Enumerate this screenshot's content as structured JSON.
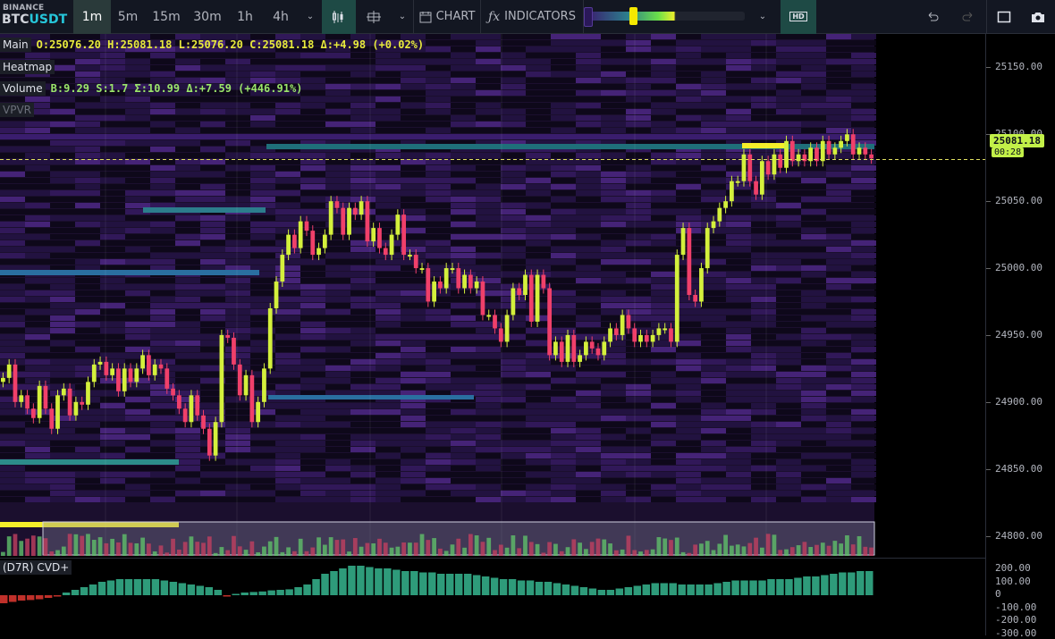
{
  "toolbar": {
    "exchange": "BINANCE",
    "symbol_base": "BTC",
    "symbol_quote": "USDT",
    "timeframes": [
      "1m",
      "5m",
      "15m",
      "30m",
      "1h",
      "4h"
    ],
    "active_timeframe": "1m",
    "chart_label": "CHART",
    "indicators_label": "INDICATORS",
    "hd_label": "HD"
  },
  "legend": {
    "main_tag": "Main",
    "main_values": "O:25076.20 H:25081.18 L:25076.20 C:25081.18 Δ:+4.98 (+0.02%)",
    "heatmap_tag": "Heatmap",
    "volume_tag": "Volume",
    "volume_values": "B:9.29 S:1.7 Σ:10.99 Δ:+7.59 (+446.91%)",
    "vpvr_tag": "VPVR"
  },
  "price_axis": {
    "ticks": [
      "25150.00",
      "25100.00",
      "25050.00",
      "25000.00",
      "24950.00",
      "24900.00",
      "24850.00",
      "24800.00"
    ],
    "last_price": "25081.18",
    "countdown": "00:28"
  },
  "cvd": {
    "label": "(D7R) CVD+",
    "ticks": [
      "200.00",
      "100.00",
      "0",
      "-100.00",
      "-200.00",
      "-300.00"
    ]
  },
  "colors": {
    "bull": "#d4f03c",
    "bear": "#f0406a",
    "cvd_pos": "#2e9b7a",
    "cvd_neg": "#c0302a",
    "heat_low": "#2a1552",
    "heat_high": "#f5ee2a"
  },
  "chart_data": {
    "type": "candlestick",
    "y_range": [
      24785,
      25175
    ],
    "closes": [
      24918,
      24928,
      24900,
      24905,
      24895,
      24888,
      24912,
      24895,
      24880,
      24905,
      24910,
      24890,
      24900,
      24898,
      24915,
      24928,
      24930,
      24920,
      24925,
      24908,
      24925,
      24915,
      24925,
      24935,
      24920,
      24928,
      24925,
      24910,
      24905,
      24895,
      24885,
      24905,
      24890,
      24880,
      24860,
      24885,
      24950,
      24948,
      24928,
      24905,
      24920,
      24885,
      24900,
      24925,
      24970,
      24990,
      25010,
      25025,
      25015,
      25035,
      25028,
      25010,
      25015,
      25025,
      25050,
      25045,
      25025,
      25045,
      25040,
      25050,
      25020,
      25030,
      25015,
      25010,
      25025,
      25040,
      25010,
      25010,
      25000,
      25000,
      24975,
      24990,
      24985,
      25000,
      25000,
      24985,
      24995,
      24985,
      24990,
      24965,
      24965,
      24955,
      24945,
      24965,
      24985,
      24980,
      24995,
      24960,
      24995,
      24985,
      24935,
      24945,
      24930,
      24950,
      24930,
      24935,
      24945,
      24940,
      24935,
      24945,
      24955,
      24950,
      24965,
      24955,
      24945,
      24950,
      24945,
      24950,
      24955,
      24955,
      24945,
      25010,
      25030,
      24980,
      24975,
      25000,
      25030,
      25035,
      25045,
      25050,
      25065,
      25065,
      25085,
      25065,
      25055,
      25080,
      25070,
      25085,
      25075,
      25095,
      25080,
      25085,
      25080,
      25090,
      25080,
      25095,
      25085,
      25090,
      25095,
      25100,
      25085,
      25090,
      25085,
      25082
    ],
    "cvd": [
      -30,
      -25,
      -20,
      -18,
      -15,
      -10,
      -5,
      10,
      20,
      30,
      40,
      50,
      55,
      60,
      60,
      60,
      60,
      60,
      55,
      50,
      45,
      40,
      35,
      30,
      20,
      -5,
      5,
      10,
      12,
      14,
      18,
      20,
      22,
      30,
      40,
      60,
      80,
      90,
      100,
      110,
      110,
      105,
      100,
      100,
      95,
      90,
      90,
      85,
      85,
      80,
      80,
      80,
      80,
      75,
      70,
      65,
      60,
      60,
      55,
      55,
      50,
      50,
      45,
      40,
      35,
      30,
      25,
      20,
      20,
      25,
      30,
      35,
      40,
      45,
      45,
      45,
      40,
      40,
      40,
      40,
      45,
      50,
      55,
      55,
      55,
      55,
      60,
      60,
      60,
      65,
      70,
      70,
      75,
      80,
      85,
      85,
      90,
      90
    ]
  }
}
